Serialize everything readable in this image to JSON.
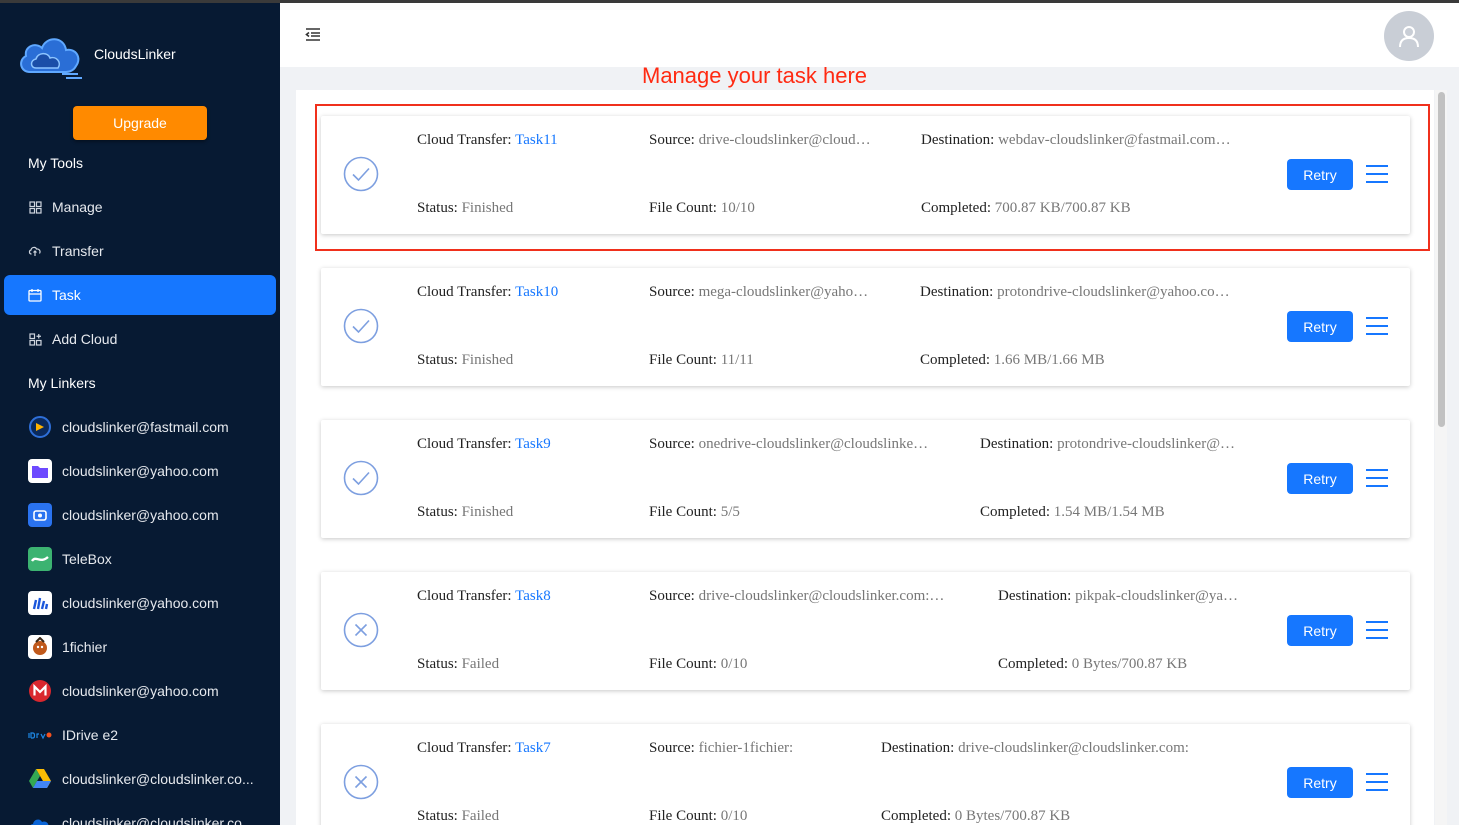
{
  "app": {
    "name": "CloudsLinker"
  },
  "sidebar": {
    "upgrade_label": "Upgrade",
    "my_tools_title": "My Tools",
    "nav": [
      {
        "label": "Manage",
        "icon": "grid-icon"
      },
      {
        "label": "Transfer",
        "icon": "cloud-transfer-icon"
      },
      {
        "label": "Task",
        "icon": "calendar-icon",
        "active": true
      },
      {
        "label": "Add Cloud",
        "icon": "add-grid-icon"
      }
    ],
    "my_linkers_title": "My Linkers",
    "linkers": [
      {
        "label": "cloudslinker@fastmail.com",
        "icon": "fastmail-icon",
        "color": "#1f3d7a"
      },
      {
        "label": "cloudslinker@yahoo.com",
        "icon": "proton-drive-icon",
        "color": "#6d4aff"
      },
      {
        "label": "cloudslinker@yahoo.com",
        "icon": "pcloud-icon",
        "color": "#2a73f0"
      },
      {
        "label": "TeleBox",
        "icon": "telebox-icon",
        "color": "#3cb371"
      },
      {
        "label": "cloudslinker@yahoo.com",
        "icon": "icedrive-icon",
        "color": "#ffffff"
      },
      {
        "label": "1fichier",
        "icon": "1fichier-icon",
        "color": "#ffffff"
      },
      {
        "label": "cloudslinker@yahoo.com",
        "icon": "mega-icon",
        "color": "#d9272e"
      },
      {
        "label": "IDrive e2",
        "icon": "idrive-icon",
        "color": "#1e88e5"
      },
      {
        "label": "cloudslinker@cloudslinker.co...",
        "icon": "google-drive-icon",
        "color": "#34a853"
      },
      {
        "label": "cloudslinker@cloudslinker.co",
        "icon": "onedrive-icon",
        "color": "#0a64d6"
      }
    ]
  },
  "annotation": "Manage your task here",
  "labels": {
    "cloud_transfer": "Cloud Transfer:",
    "source": "Source:",
    "destination": "Destination:",
    "status": "Status:",
    "file_count": "File Count:",
    "completed": "Completed:",
    "retry": "Retry"
  },
  "tasks": [
    {
      "name": "Task11",
      "source": "drive-cloudslinker@cloud…",
      "destination": "webdav-cloudslinker@fastmail.com…",
      "status": "Finished",
      "file_count": "10/10",
      "completed": "700.87 KB/700.87 KB"
    },
    {
      "name": "Task10",
      "source": "mega-cloudslinker@yaho…",
      "destination": "protondrive-cloudslinker@yahoo.co…",
      "status": "Finished",
      "file_count": "11/11",
      "completed": "1.66 MB/1.66 MB"
    },
    {
      "name": "Task9",
      "source": "onedrive-cloudslinker@cloudslinke…",
      "destination": "protondrive-cloudslinker@…",
      "status": "Finished",
      "file_count": "5/5",
      "completed": "1.54 MB/1.54 MB"
    },
    {
      "name": "Task8",
      "source": "drive-cloudslinker@cloudslinker.com:…",
      "destination": "pikpak-cloudslinker@ya…",
      "status": "Failed",
      "file_count": "0/10",
      "completed": "0 Bytes/700.87 KB"
    },
    {
      "name": "Task7",
      "source": "fichier-1fichier:",
      "destination": "drive-cloudslinker@cloudslinker.com:",
      "status": "Failed",
      "file_count": "0/10",
      "completed": "0 Bytes/700.87 KB"
    }
  ]
}
